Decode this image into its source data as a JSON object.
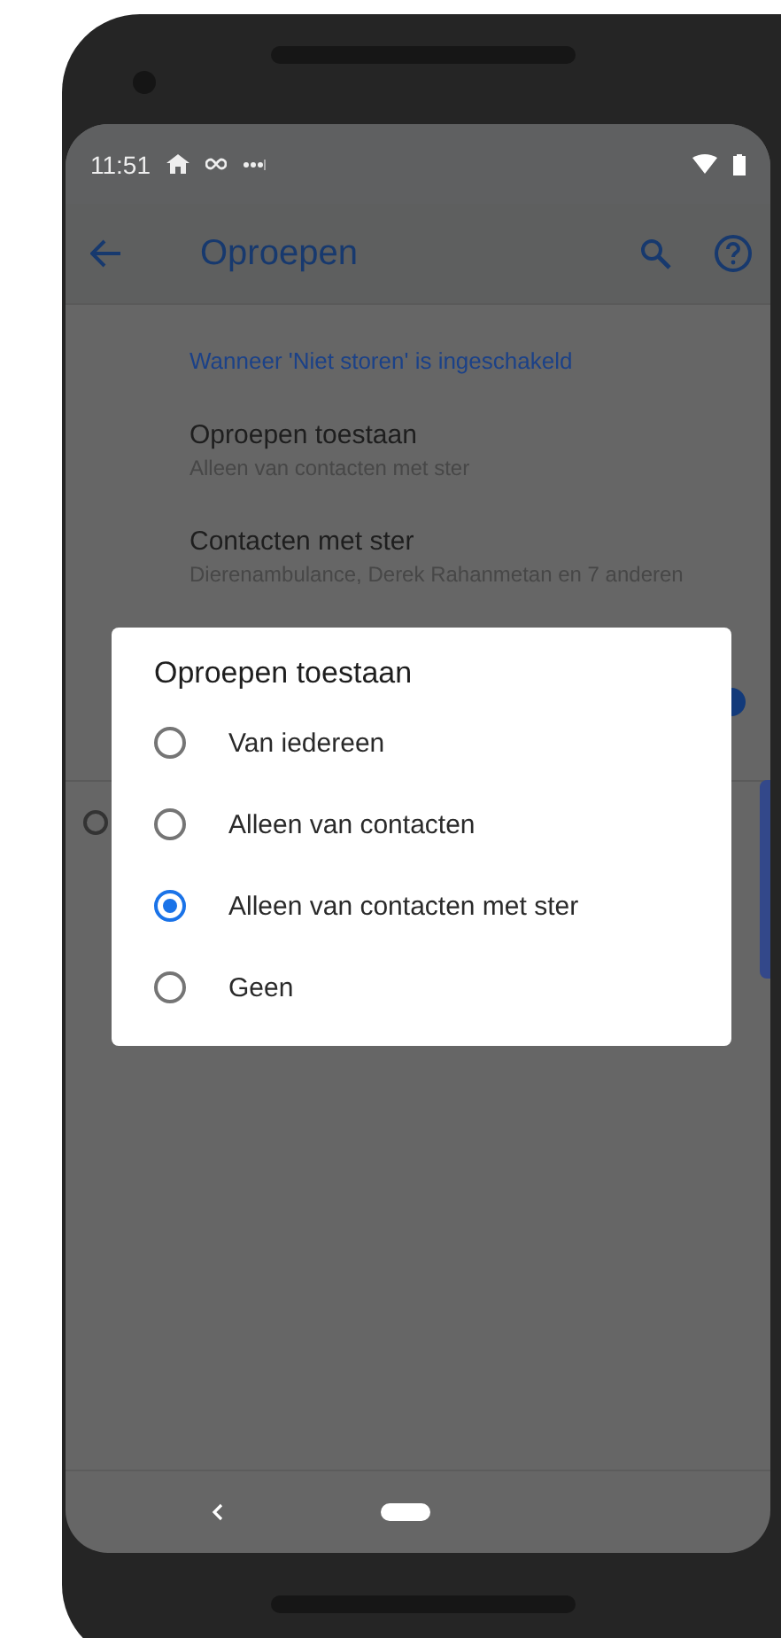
{
  "status_bar": {
    "time": "11:51"
  },
  "app_bar": {
    "title": "Oproepen"
  },
  "section_header": "Wanneer 'Niet storen' is ingeschakeld",
  "settings": [
    {
      "title": "Oproepen toestaan",
      "subtitle": "Alleen van contacten met ster"
    },
    {
      "title": "Contacten met ster",
      "subtitle": "Dierenambulance, Derek Rahanmetan en 7 anderen"
    }
  ],
  "background_controls": {
    "switch": {
      "on": true
    },
    "radio": {
      "selected": false
    }
  },
  "dialog": {
    "title": "Oproepen toestaan",
    "options": [
      {
        "label": "Van iedereen",
        "selected": false
      },
      {
        "label": "Alleen van contacten",
        "selected": false
      },
      {
        "label": "Alleen van contacten met ster",
        "selected": true
      },
      {
        "label": "Geen",
        "selected": false
      }
    ]
  }
}
